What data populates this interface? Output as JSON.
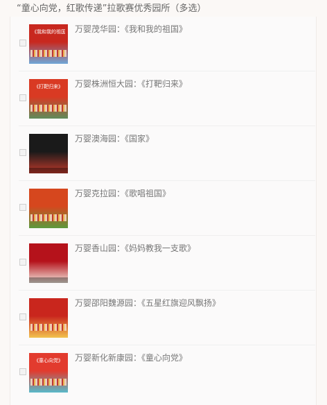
{
  "question": {
    "title": "“童心向党，红歌传递”拉歌赛优秀园所（多选）"
  },
  "options": [
    {
      "label": "万婴茂华园：《我和我的祖国》",
      "thumb_caption": "《我和我的祖国》",
      "thumb_color": "#c8281f",
      "thumb_color2": "#6fa7d8",
      "checked": false
    },
    {
      "label": "万婴株洲恒大园：《打靶归来》",
      "thumb_caption": "《打靶归来》",
      "thumb_color": "#d93a23",
      "thumb_color2": "#5f8c5a",
      "checked": false
    },
    {
      "label": "万婴澳海园：《国家》",
      "thumb_caption": "",
      "thumb_color": "#1a1a1a",
      "thumb_color2": "#c0392b",
      "checked": false
    },
    {
      "label": "万婴克拉园：《歌唱祖国》",
      "thumb_caption": "",
      "thumb_color": "#d6471e",
      "thumb_color2": "#5c9a3c",
      "checked": false
    },
    {
      "label": "万婴香山园：《妈妈教我一支歌》",
      "thumb_caption": "",
      "thumb_color": "#b5121b",
      "thumb_color2": "#f2e6dc",
      "checked": false
    },
    {
      "label": "万婴邵阳魏源园：《五星红旗迎风飘扬》",
      "thumb_caption": "",
      "thumb_color": "#c9261d",
      "thumb_color2": "#f2c14e",
      "checked": false
    },
    {
      "label": "万婴新化新康园：《童心向党》",
      "thumb_caption": "《童心向党》",
      "thumb_color": "#e23b2e",
      "thumb_color2": "#58b9c9",
      "checked": false
    }
  ]
}
